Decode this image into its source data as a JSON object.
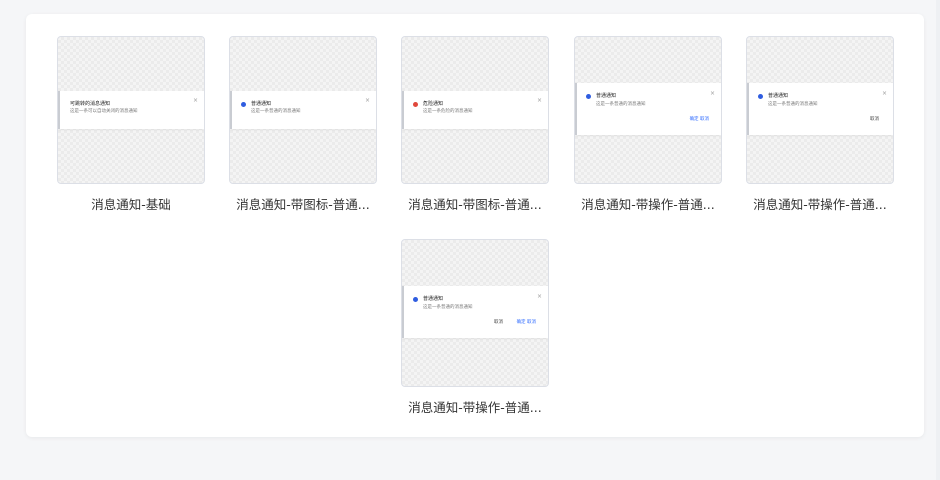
{
  "colors": {
    "info_dot": "#2f5de0",
    "danger_dot": "#e0483c",
    "link": "#2f6bff",
    "accent_bar": "#c9ccd2"
  },
  "icons": {
    "close": "×"
  },
  "cards": [
    {
      "caption": "消息通知-基础",
      "title": "可跳转的消息通知",
      "body": "这是一条可以自动关闭的消息通知"
    },
    {
      "caption": "消息通知-带图标-普通...",
      "title": "普通通知",
      "body": "这是一条普通的消息通知"
    },
    {
      "caption": "消息通知-带图标-普通...",
      "title": "危险通知",
      "body": "这是一条危险的消息通知"
    },
    {
      "caption": "消息通知-带操作-普通...",
      "title": "普通通知",
      "body": "这是一条普通的消息通知",
      "action": "确定 取消"
    },
    {
      "caption": "消息通知-带操作-普通...",
      "title": "普通通知",
      "body": "这是一条普通的消息通知",
      "action": "取消"
    },
    {
      "caption": "消息通知-带操作-普通...",
      "title": "普通通知",
      "body": "这是一条普通的消息通知",
      "cancel": "取消",
      "confirm": "确定 取消"
    }
  ]
}
